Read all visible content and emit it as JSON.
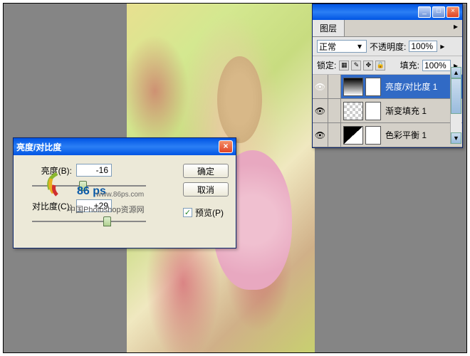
{
  "dialog": {
    "title": "亮度/对比度",
    "brightness_label": "亮度(B):",
    "brightness_value": "-16",
    "contrast_label": "对比度(C):",
    "contrast_value": "+29",
    "ok": "确定",
    "cancel": "取消",
    "preview": "预览(P)",
    "close_x": "×"
  },
  "watermark": {
    "brand": "86 ps",
    "url": "www.86ps.com",
    "cn": "中国Photoshop资源网"
  },
  "layers_panel": {
    "tab": "图层",
    "blend_mode": "正常",
    "opacity_label": "不透明度:",
    "opacity_value": "100%",
    "lock_label": "锁定:",
    "fill_label": "填充:",
    "fill_value": "100%",
    "layers": [
      {
        "name": "亮度/对比度 1",
        "active": true,
        "thumb": "grad"
      },
      {
        "name": "渐变填充 1",
        "active": false,
        "thumb": "checker"
      },
      {
        "name": "色彩平衡 1",
        "active": false,
        "thumb": "triangle"
      }
    ],
    "min": "_",
    "max": "□",
    "close": "×"
  },
  "icons": {
    "eye": "👁",
    "arrow": "▸",
    "dropdown": "▾",
    "check": "✓",
    "scroll_up": "▲",
    "scroll_down": "▼"
  }
}
